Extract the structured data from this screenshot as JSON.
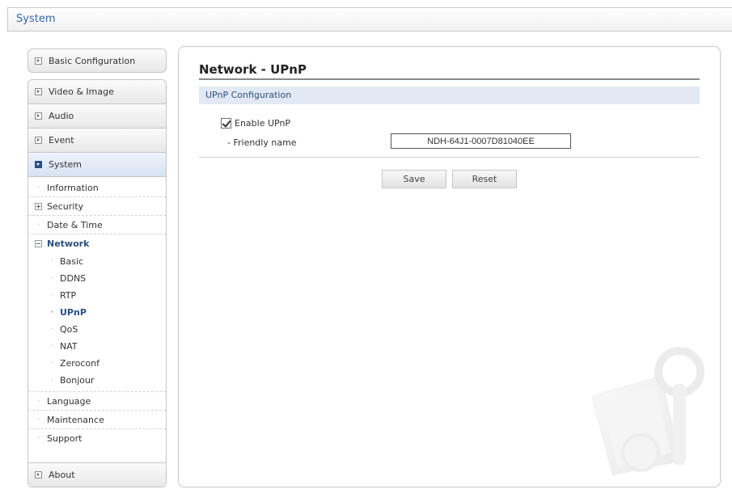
{
  "header": {
    "title": "System"
  },
  "sidebar": {
    "basic_configuration": "Basic Configuration",
    "video_image": "Video & Image",
    "audio": "Audio",
    "event": "Event",
    "system": "System",
    "system_items": {
      "information": "Information",
      "security": "Security",
      "date_time": "Date & Time",
      "network": "Network",
      "network_items": [
        "Basic",
        "DDNS",
        "RTP",
        "UPnP",
        "QoS",
        "NAT",
        "Zeroconf",
        "Bonjour"
      ],
      "language": "Language",
      "maintenance": "Maintenance",
      "support": "Support"
    },
    "about": "About"
  },
  "main": {
    "title": "Network - UPnP",
    "section": "UPnP Configuration",
    "enable_label": "Enable UPnP",
    "enable_checked": true,
    "friendly_name_label": "- Friendly name",
    "friendly_name_value": "NDH-64J1-0007D81040EE",
    "save_label": "Save",
    "reset_label": "Reset"
  },
  "colors": {
    "accent": "#2b4f82",
    "section_bg": "#e3e9f4"
  }
}
